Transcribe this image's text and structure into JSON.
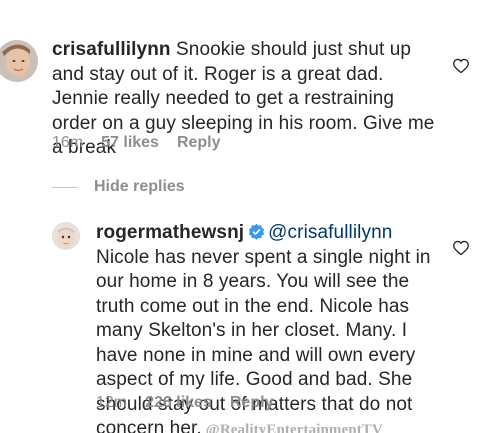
{
  "comments": [
    {
      "username": "crisafullilynn",
      "body": "Snookie should just shut up and stay out of it. Roger is a great dad.  Jennie really needed to get a restraining order on a guy sleeping in his room.  Give me a break",
      "time": "16m",
      "likes": "57 likes",
      "reply": "Reply",
      "avatar_icon": "profile-photo-woman",
      "like_icon": "heart-outline-icon"
    },
    {
      "username": "rogermathewsnj",
      "verified_icon": "verified-badge-icon",
      "mention": "@crisafullilynn",
      "body": " Nicole has never spent a single night in our home in 8 years. You will see the truth come out in the end. Nicole has many Skelton's in her closet. Many. I have none in mine and will own every aspect of my life. Good and bad. She should stay out of matters that do not concern her.",
      "watermark": "@RealityEntertainmentTV",
      "time": "12m",
      "likes": "226 likes",
      "reply": "Reply",
      "avatar_icon": "profile-photo-baby",
      "like_icon": "heart-outline-icon"
    }
  ],
  "hide_replies": "Hide replies",
  "colors": {
    "text": "#262626",
    "secondary": "#8e8e8e",
    "mention": "#00376b",
    "verified": "#3897f0"
  }
}
